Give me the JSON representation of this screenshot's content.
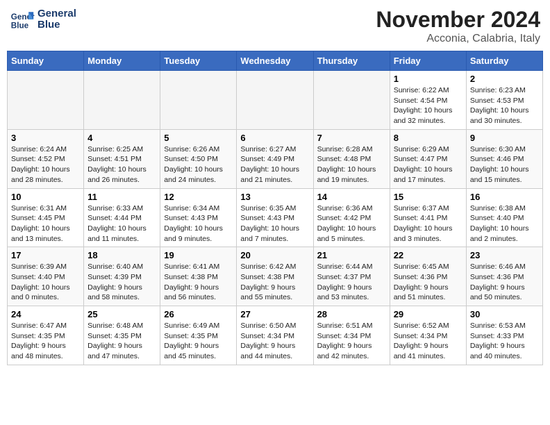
{
  "header": {
    "logo_line1": "General",
    "logo_line2": "Blue",
    "month_title": "November 2024",
    "location": "Acconia, Calabria, Italy"
  },
  "days_of_week": [
    "Sunday",
    "Monday",
    "Tuesday",
    "Wednesday",
    "Thursday",
    "Friday",
    "Saturday"
  ],
  "weeks": [
    [
      {
        "day": "",
        "empty": true
      },
      {
        "day": "",
        "empty": true
      },
      {
        "day": "",
        "empty": true
      },
      {
        "day": "",
        "empty": true
      },
      {
        "day": "",
        "empty": true
      },
      {
        "day": "1",
        "sunrise": "6:22 AM",
        "sunset": "4:54 PM",
        "daylight": "10 hours and 32 minutes."
      },
      {
        "day": "2",
        "sunrise": "6:23 AM",
        "sunset": "4:53 PM",
        "daylight": "10 hours and 30 minutes."
      }
    ],
    [
      {
        "day": "3",
        "sunrise": "6:24 AM",
        "sunset": "4:52 PM",
        "daylight": "10 hours and 28 minutes."
      },
      {
        "day": "4",
        "sunrise": "6:25 AM",
        "sunset": "4:51 PM",
        "daylight": "10 hours and 26 minutes."
      },
      {
        "day": "5",
        "sunrise": "6:26 AM",
        "sunset": "4:50 PM",
        "daylight": "10 hours and 24 minutes."
      },
      {
        "day": "6",
        "sunrise": "6:27 AM",
        "sunset": "4:49 PM",
        "daylight": "10 hours and 21 minutes."
      },
      {
        "day": "7",
        "sunrise": "6:28 AM",
        "sunset": "4:48 PM",
        "daylight": "10 hours and 19 minutes."
      },
      {
        "day": "8",
        "sunrise": "6:29 AM",
        "sunset": "4:47 PM",
        "daylight": "10 hours and 17 minutes."
      },
      {
        "day": "9",
        "sunrise": "6:30 AM",
        "sunset": "4:46 PM",
        "daylight": "10 hours and 15 minutes."
      }
    ],
    [
      {
        "day": "10",
        "sunrise": "6:31 AM",
        "sunset": "4:45 PM",
        "daylight": "10 hours and 13 minutes."
      },
      {
        "day": "11",
        "sunrise": "6:33 AM",
        "sunset": "4:44 PM",
        "daylight": "10 hours and 11 minutes."
      },
      {
        "day": "12",
        "sunrise": "6:34 AM",
        "sunset": "4:43 PM",
        "daylight": "10 hours and 9 minutes."
      },
      {
        "day": "13",
        "sunrise": "6:35 AM",
        "sunset": "4:43 PM",
        "daylight": "10 hours and 7 minutes."
      },
      {
        "day": "14",
        "sunrise": "6:36 AM",
        "sunset": "4:42 PM",
        "daylight": "10 hours and 5 minutes."
      },
      {
        "day": "15",
        "sunrise": "6:37 AM",
        "sunset": "4:41 PM",
        "daylight": "10 hours and 3 minutes."
      },
      {
        "day": "16",
        "sunrise": "6:38 AM",
        "sunset": "4:40 PM",
        "daylight": "10 hours and 2 minutes."
      }
    ],
    [
      {
        "day": "17",
        "sunrise": "6:39 AM",
        "sunset": "4:40 PM",
        "daylight": "10 hours and 0 minutes."
      },
      {
        "day": "18",
        "sunrise": "6:40 AM",
        "sunset": "4:39 PM",
        "daylight": "9 hours and 58 minutes."
      },
      {
        "day": "19",
        "sunrise": "6:41 AM",
        "sunset": "4:38 PM",
        "daylight": "9 hours and 56 minutes."
      },
      {
        "day": "20",
        "sunrise": "6:42 AM",
        "sunset": "4:38 PM",
        "daylight": "9 hours and 55 minutes."
      },
      {
        "day": "21",
        "sunrise": "6:44 AM",
        "sunset": "4:37 PM",
        "daylight": "9 hours and 53 minutes."
      },
      {
        "day": "22",
        "sunrise": "6:45 AM",
        "sunset": "4:36 PM",
        "daylight": "9 hours and 51 minutes."
      },
      {
        "day": "23",
        "sunrise": "6:46 AM",
        "sunset": "4:36 PM",
        "daylight": "9 hours and 50 minutes."
      }
    ],
    [
      {
        "day": "24",
        "sunrise": "6:47 AM",
        "sunset": "4:35 PM",
        "daylight": "9 hours and 48 minutes."
      },
      {
        "day": "25",
        "sunrise": "6:48 AM",
        "sunset": "4:35 PM",
        "daylight": "9 hours and 47 minutes."
      },
      {
        "day": "26",
        "sunrise": "6:49 AM",
        "sunset": "4:35 PM",
        "daylight": "9 hours and 45 minutes."
      },
      {
        "day": "27",
        "sunrise": "6:50 AM",
        "sunset": "4:34 PM",
        "daylight": "9 hours and 44 minutes."
      },
      {
        "day": "28",
        "sunrise": "6:51 AM",
        "sunset": "4:34 PM",
        "daylight": "9 hours and 42 minutes."
      },
      {
        "day": "29",
        "sunrise": "6:52 AM",
        "sunset": "4:34 PM",
        "daylight": "9 hours and 41 minutes."
      },
      {
        "day": "30",
        "sunrise": "6:53 AM",
        "sunset": "4:33 PM",
        "daylight": "9 hours and 40 minutes."
      }
    ]
  ]
}
